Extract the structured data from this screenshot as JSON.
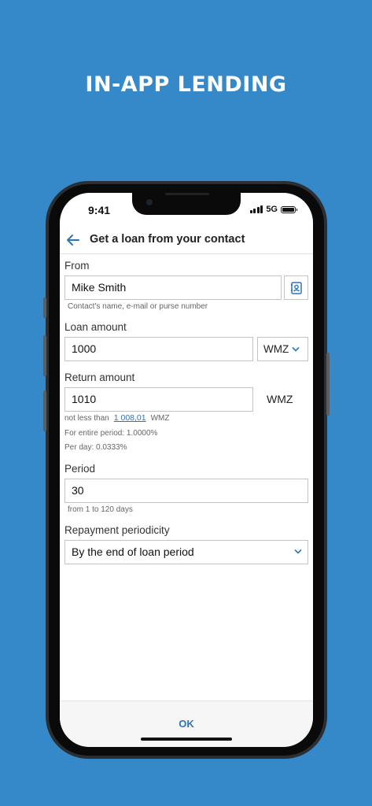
{
  "promo": {
    "title": "IN-APP LENDING"
  },
  "status_bar": {
    "time": "9:41",
    "network": "5G"
  },
  "header": {
    "title": "Get a loan from your contact"
  },
  "form": {
    "from": {
      "label": "From",
      "value": "Mike Smith",
      "hint": "Contact's name, e-mail or purse number"
    },
    "loan_amount": {
      "label": "Loan amount",
      "value": "1000",
      "currency": "WMZ"
    },
    "return_amount": {
      "label": "Return amount",
      "value": "1010",
      "currency": "WMZ",
      "min_prefix": "not less than",
      "min_value": "1 008,01",
      "min_currency": "WMZ",
      "entire_period": "For entire period: 1.0000%",
      "per_day": "Per day: 0.0333%"
    },
    "period": {
      "label": "Period",
      "value": "30",
      "hint": "from 1 to 120 days"
    },
    "repayment": {
      "label": "Repayment periodicity",
      "value": "By the end of loan period"
    }
  },
  "footer": {
    "ok_label": "OK"
  },
  "colors": {
    "background": "#3589c9",
    "accent": "#2f74b9"
  }
}
